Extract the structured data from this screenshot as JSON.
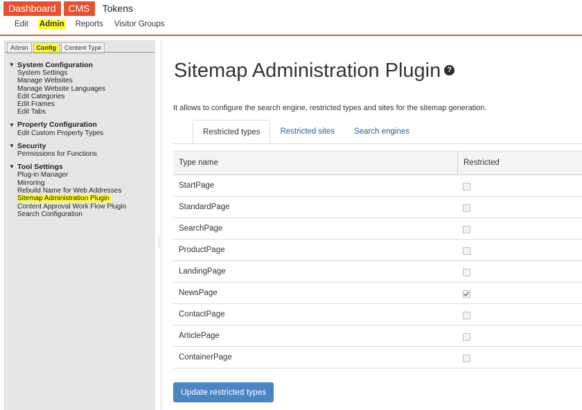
{
  "header": {
    "product_tabs": [
      {
        "label": "Dashboard",
        "active": true
      },
      {
        "label": "CMS",
        "active": true
      },
      {
        "label": "Tokens",
        "active": false
      }
    ],
    "subnav": [
      {
        "label": "Edit",
        "active": false
      },
      {
        "label": "Admin",
        "active": true
      },
      {
        "label": "Reports",
        "active": false
      },
      {
        "label": "Visitor Groups",
        "active": false
      }
    ],
    "accent_color": "#e8502f",
    "highlight_color": "#ffff24"
  },
  "sidebar": {
    "tabs": [
      {
        "label": "Admin",
        "active": false
      },
      {
        "label": "Config",
        "active": true
      },
      {
        "label": "Content Type",
        "active": false
      }
    ],
    "groups": [
      {
        "title": "System Configuration",
        "items": [
          "System Settings",
          "Manage Websites",
          "Manage Website Languages",
          "Edit Categories",
          "Edit Frames",
          "Edit Tabs"
        ]
      },
      {
        "title": "Property Configuration",
        "items": [
          "Edit Custom Property Types"
        ]
      },
      {
        "title": "Security",
        "items": [
          "Permissions for Functions"
        ]
      },
      {
        "title": "Tool Settings",
        "items": [
          "Plug-in Manager",
          "Mirroring",
          "Rebuild Name for Web Addresses",
          "Sitemap Administration Plugin",
          "Content Approval Work Flow Plugin",
          "Search Configuration"
        ]
      }
    ],
    "highlighted_item": "Sitemap Administration Plugin"
  },
  "main": {
    "title": "Sitemap Administration Plugin",
    "help_icon": "?",
    "description": "It allows to configure the search engine, restricted types and sites for the sitemap generation.",
    "tabs": [
      {
        "label": "Restricted types",
        "active": true
      },
      {
        "label": "Restricted sites",
        "active": false
      },
      {
        "label": "Search engines",
        "active": false
      }
    ],
    "columns": [
      "Type name",
      "Restricted"
    ],
    "rows": [
      {
        "type_name": "StartPage",
        "restricted": false
      },
      {
        "type_name": "StandardPage",
        "restricted": false
      },
      {
        "type_name": "SearchPage",
        "restricted": false
      },
      {
        "type_name": "ProductPage",
        "restricted": false
      },
      {
        "type_name": "LandingPage",
        "restricted": false
      },
      {
        "type_name": "NewsPage",
        "restricted": true
      },
      {
        "type_name": "ContactPage",
        "restricted": false
      },
      {
        "type_name": "ArticlePage",
        "restricted": false
      },
      {
        "type_name": "ContainerPage",
        "restricted": false
      }
    ],
    "update_button_label": "Update restricted types",
    "button_color": "#4a86c5",
    "link_color": "#1e5fb2"
  }
}
